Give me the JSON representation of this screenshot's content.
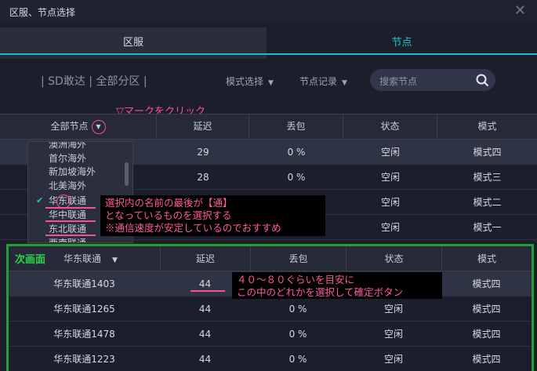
{
  "window": {
    "title": "区服、节点选择",
    "close": "✕"
  },
  "tabs": [
    {
      "label": "区服"
    },
    {
      "label": "节点"
    }
  ],
  "filter": {
    "tag": "| SD敢达 | 全部分区 |",
    "mode_select": "模式选择",
    "record": "节点记录",
    "search_placeholder": "搜索节点"
  },
  "annotations": {
    "click_hint": "▽マークをクリック",
    "dropdown_note": [
      "選択内の名前の最後が【通】",
      "となっているものを選択する",
      "※通信速度が安定しているのでおすすめ"
    ],
    "latency_note": [
      "４０～８０ぐらいを目安に",
      "この中のどれかを選択して確定ボタン"
    ],
    "next_screen": "次画面"
  },
  "table": {
    "headers": [
      "全部节点",
      "延迟",
      "丢包",
      "状态",
      "模式"
    ],
    "rows": [
      {
        "latency": "29",
        "loss": "0 %",
        "status": "空闲",
        "mode": "模式四"
      },
      {
        "latency": "28",
        "loss": "0 %",
        "status": "空闲",
        "mode": "模式三"
      },
      {
        "latency": "",
        "loss": "0 %",
        "status": "空闲",
        "mode": "模式二"
      },
      {
        "latency": "",
        "loss": "",
        "status": "空闲",
        "mode": "模式一"
      }
    ]
  },
  "dropdown": {
    "items": [
      "澳洲海外",
      "首尔海外",
      "新加坡海外",
      "北美海外",
      "华东联通",
      "华中联通",
      "东北联通",
      "西南联通"
    ],
    "checked": "✔"
  },
  "next": {
    "selected_node": "华东联通",
    "headers": [
      "延迟",
      "丢包",
      "状态",
      "模式"
    ],
    "rows": [
      {
        "name": "华东联通1403",
        "latency": "44",
        "loss": "",
        "status": "空闲",
        "mode": "模式四"
      },
      {
        "name": "华东联通1265",
        "latency": "44",
        "loss": "0 %",
        "status": "空闲",
        "mode": "模式四"
      },
      {
        "name": "华东联通1478",
        "latency": "44",
        "loss": "0 %",
        "status": "空闲",
        "mode": "模式四"
      },
      {
        "name": "华东联通1223",
        "latency": "44",
        "loss": "0 %",
        "status": "空闲",
        "mode": "模式四"
      }
    ]
  },
  "colors": {
    "accent": "#21c5c9",
    "annotation": "#ff4d92",
    "frame": "#1ea13b"
  }
}
